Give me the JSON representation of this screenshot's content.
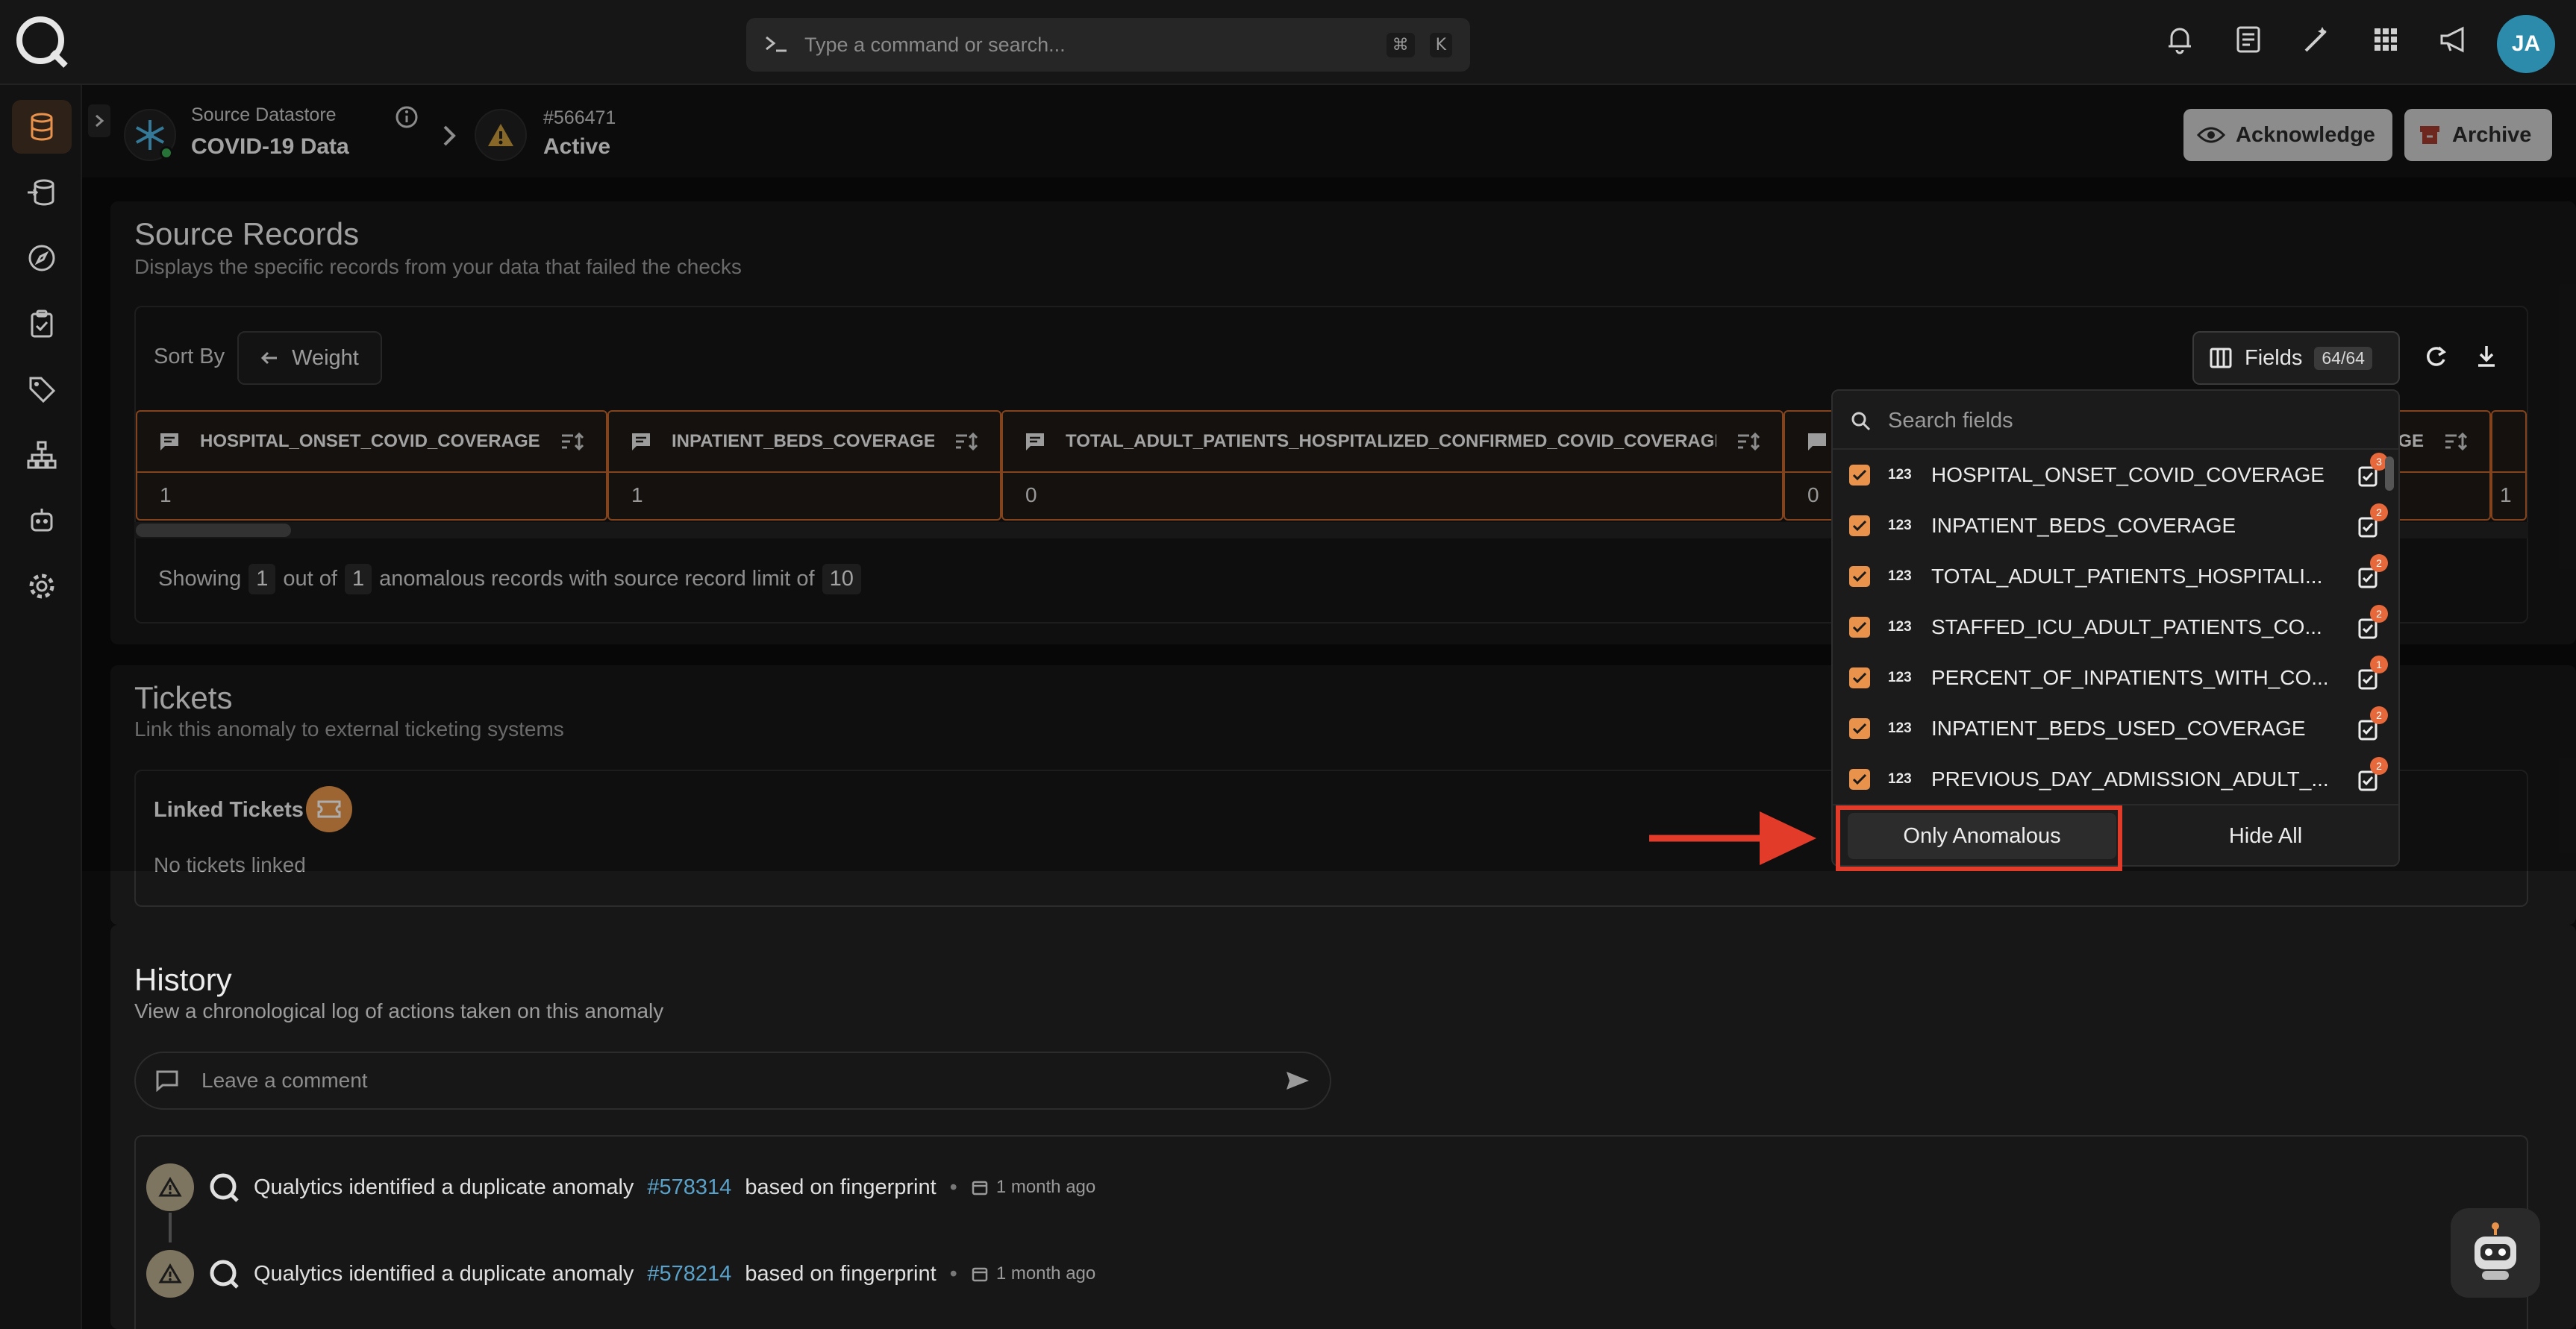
{
  "search": {
    "placeholder": "Type a command or search...",
    "kbd1": "⌘",
    "kbd2": "K"
  },
  "user": {
    "initials": "JA"
  },
  "breadcrumb": {
    "datastore_label": "Source Datastore",
    "datastore_name": "COVID-19 Data",
    "anomaly_id": "#566471",
    "anomaly_status": "Active"
  },
  "actions": {
    "acknowledge": "Acknowledge",
    "archive": "Archive"
  },
  "source_records": {
    "title": "Source Records",
    "subtitle": "Displays the specific records from your data that failed the checks",
    "sort_label": "Sort By",
    "sort_value": "Weight",
    "fields_label": "Fields",
    "fields_count": "64/64",
    "columns": [
      {
        "name": "HOSPITAL_ONSET_COVID_COVERAGE",
        "value": "1"
      },
      {
        "name": "INPATIENT_BEDS_COVERAGE",
        "value": "1"
      },
      {
        "name": "TOTAL_ADULT_PATIENTS_HOSPITALIZED_CONFIRMED_COVID_COVERAGE",
        "value": "0"
      },
      {
        "name": "",
        "value": "0"
      },
      {
        "name": "GE",
        "value": ""
      },
      {
        "name": "",
        "value": "1"
      }
    ],
    "showing_prefix": "Showing",
    "showing_count": "1",
    "showing_out_of": "out of",
    "showing_total": "1",
    "showing_suffix": "anomalous records with source record limit of",
    "showing_limit": "10"
  },
  "fields_dropdown": {
    "search_placeholder": "Search fields",
    "type_icon": "123",
    "items": [
      {
        "label": "HOSPITAL_ONSET_COVID_COVERAGE",
        "badge": "3"
      },
      {
        "label": "INPATIENT_BEDS_COVERAGE",
        "badge": "2"
      },
      {
        "label": "TOTAL_ADULT_PATIENTS_HOSPITALI...",
        "badge": "2"
      },
      {
        "label": "STAFFED_ICU_ADULT_PATIENTS_CO...",
        "badge": "2"
      },
      {
        "label": "PERCENT_OF_INPATIENTS_WITH_CO...",
        "badge": "1"
      },
      {
        "label": "INPATIENT_BEDS_USED_COVERAGE",
        "badge": "2"
      },
      {
        "label": "PREVIOUS_DAY_ADMISSION_ADULT_...",
        "badge": "2"
      }
    ],
    "only_anomalous": "Only Anomalous",
    "hide_all": "Hide All"
  },
  "tickets": {
    "title": "Tickets",
    "subtitle": "Link this anomaly to external ticketing systems",
    "linked_label": "Linked Tickets",
    "empty": "No tickets linked"
  },
  "history": {
    "title": "History",
    "subtitle": "View a chronological log of actions taken on this anomaly",
    "comment_placeholder": "Leave a comment",
    "entries": [
      {
        "prefix": "Qualytics identified a duplicate anomaly",
        "link": "#578314",
        "suffix": "based on fingerprint",
        "time": "1 month ago"
      },
      {
        "prefix": "Qualytics identified a duplicate anomaly",
        "link": "#578214",
        "suffix": "based on fingerprint",
        "time": "1 month ago"
      }
    ]
  },
  "colors": {
    "accent": "#e9924b",
    "annotation": "#e33b2a",
    "link": "#5aa2c9"
  }
}
